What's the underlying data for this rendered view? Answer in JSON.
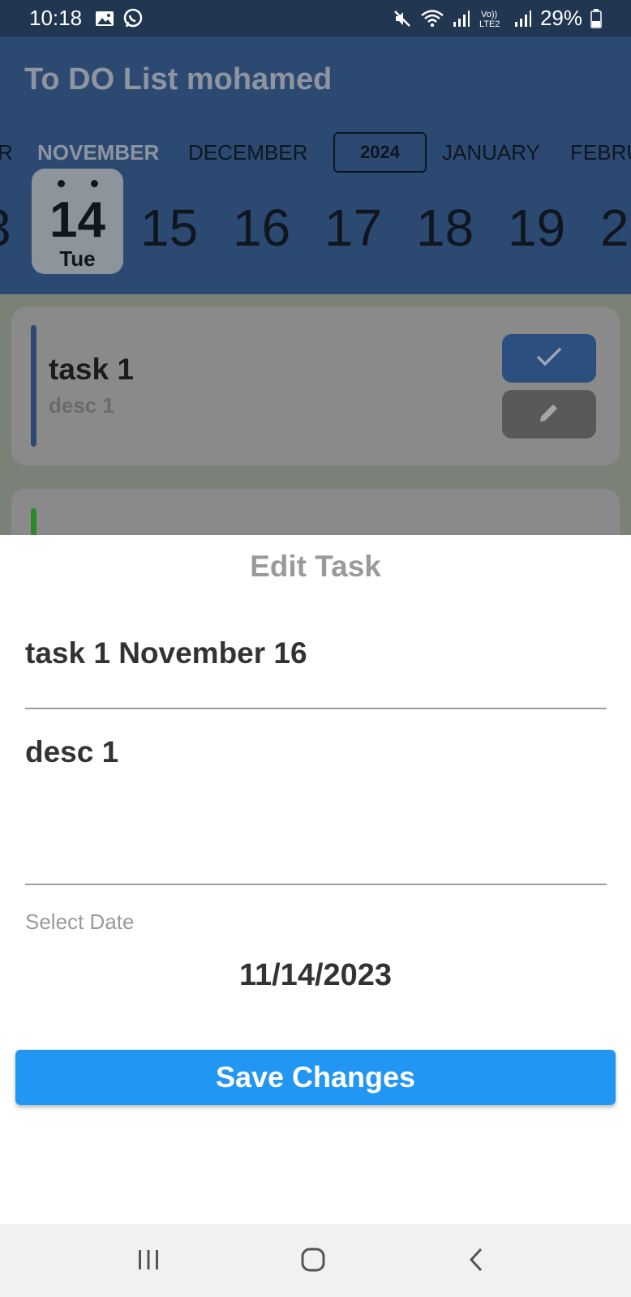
{
  "status_bar": {
    "time": "10:18",
    "battery": "29%",
    "icons_left": [
      "image-icon",
      "whatsapp-icon"
    ],
    "icons_right": [
      "mute-icon",
      "wifi-icon",
      "signal-icon",
      "volte-icon",
      "signal-icon",
      "battery-icon"
    ],
    "volte_top": "Vo))",
    "volte_bottom": "LTE2"
  },
  "header": {
    "title": "To DO List mohamed",
    "months": [
      "R",
      "NOVEMBER",
      "DECEMBER",
      "JANUARY",
      "FEBRU"
    ],
    "active_month": "NOVEMBER",
    "year": "2024",
    "days": [
      "3",
      "15",
      "16",
      "17",
      "18",
      "19",
      "2"
    ],
    "selected_day": {
      "number": "14",
      "weekday": "Tue"
    }
  },
  "task_list": [
    {
      "title": "task 1",
      "desc": "desc 1",
      "accent": "#2c4a71"
    }
  ],
  "edit_sheet": {
    "title": "Edit Task",
    "task_title_value": "task 1 November 16",
    "task_desc_value": "desc 1",
    "select_date_label": "Select Date",
    "date_value": "11/14/2023",
    "save_label": "Save Changes"
  },
  "colors": {
    "primary": "#2196f3",
    "header_bg": "#2c4a71",
    "status_bg": "#213650"
  }
}
